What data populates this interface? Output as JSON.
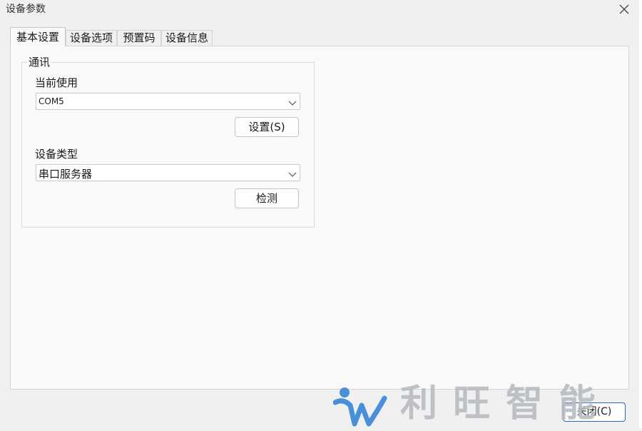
{
  "window": {
    "title": "设备参数"
  },
  "tabs": [
    {
      "label": "基本设置",
      "active": true
    },
    {
      "label": "设备选项",
      "active": false
    },
    {
      "label": "预置码",
      "active": false
    },
    {
      "label": "设备信息",
      "active": false
    }
  ],
  "comm_group": {
    "title": "通讯",
    "current_label": "当前使用",
    "current_value": "COM5",
    "settings_button": "设置(S)",
    "device_type_label": "设备类型",
    "device_type_value": "串口服务器",
    "detect_button": "检测"
  },
  "footer": {
    "close_button": "关闭(C)"
  },
  "watermark": {
    "text": "利旺智能",
    "logo": "brand-logo-icon",
    "color": "#b8bcc2",
    "logo_color": "#4a90d9"
  },
  "colors": {
    "window_bg": "#f0f0f0",
    "panel_bg": "#f9f9f9",
    "focus_border": "#2b65c7"
  },
  "icons": {
    "close": "close-icon",
    "dropdown": "chevron-down-icon"
  }
}
